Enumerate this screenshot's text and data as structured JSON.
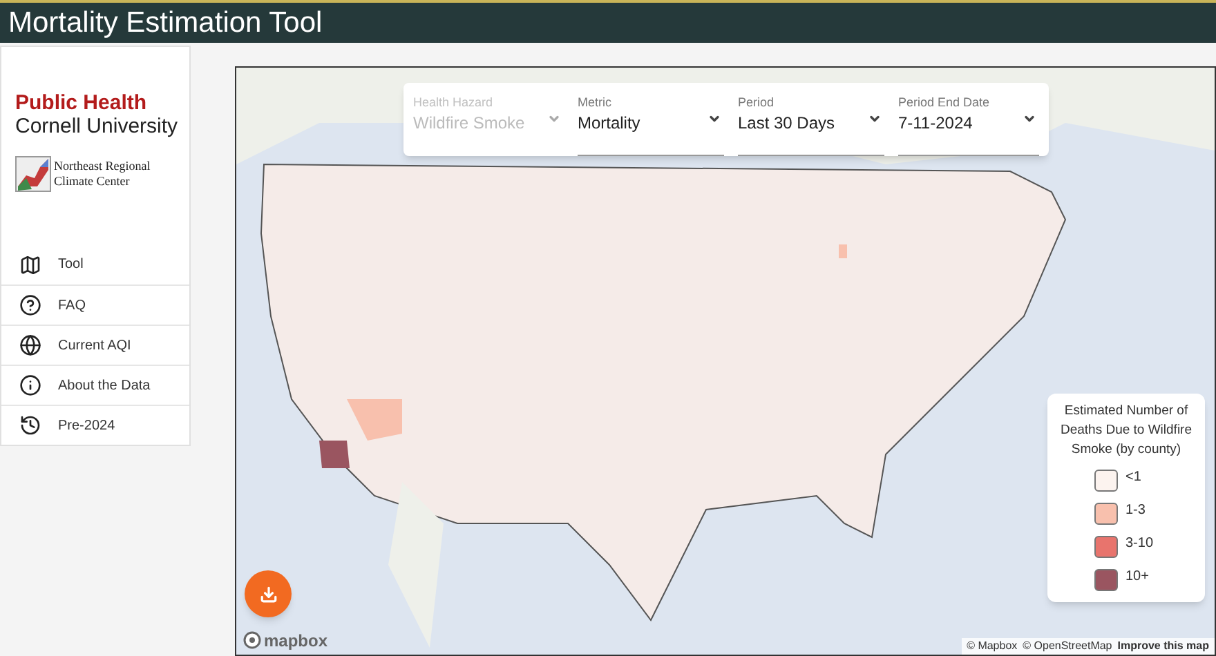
{
  "header": {
    "title": "Mortality Estimation Tool"
  },
  "sidebar": {
    "brand_line_1": "Public Health",
    "brand_line_2": "Cornell University",
    "partner_logo": "Northeast Regional Climate Center",
    "items": [
      {
        "label": "Tool",
        "kind": "map"
      },
      {
        "label": "FAQ",
        "kind": "question"
      },
      {
        "label": "Current AQI",
        "kind": "globe"
      },
      {
        "label": "About the Data",
        "kind": "info"
      },
      {
        "label": "Pre-2024",
        "kind": "history"
      }
    ]
  },
  "filters": [
    {
      "label": "Health Hazard",
      "value": "Wildfire Smoke",
      "disabled": true
    },
    {
      "label": "Metric",
      "value": "Mortality",
      "disabled": false
    },
    {
      "label": "Period",
      "value": "Last 30 Days",
      "disabled": false
    },
    {
      "label": "Period End Date",
      "value": "7-11-2024",
      "disabled": false
    }
  ],
  "legend": {
    "title": "Estimated Number of Deaths Due to Wildfire Smoke (by county)",
    "items": [
      {
        "label": "<1",
        "color": "#fcf3ef"
      },
      {
        "label": "1-3",
        "color": "#f8c0ad"
      },
      {
        "label": "3-10",
        "color": "#e8746d"
      },
      {
        "label": "10+",
        "color": "#9a5560"
      }
    ]
  },
  "map_logo": "mapbox",
  "attribution": [
    "© Mapbox",
    "© OpenStreetMap",
    "Improve this map"
  ]
}
